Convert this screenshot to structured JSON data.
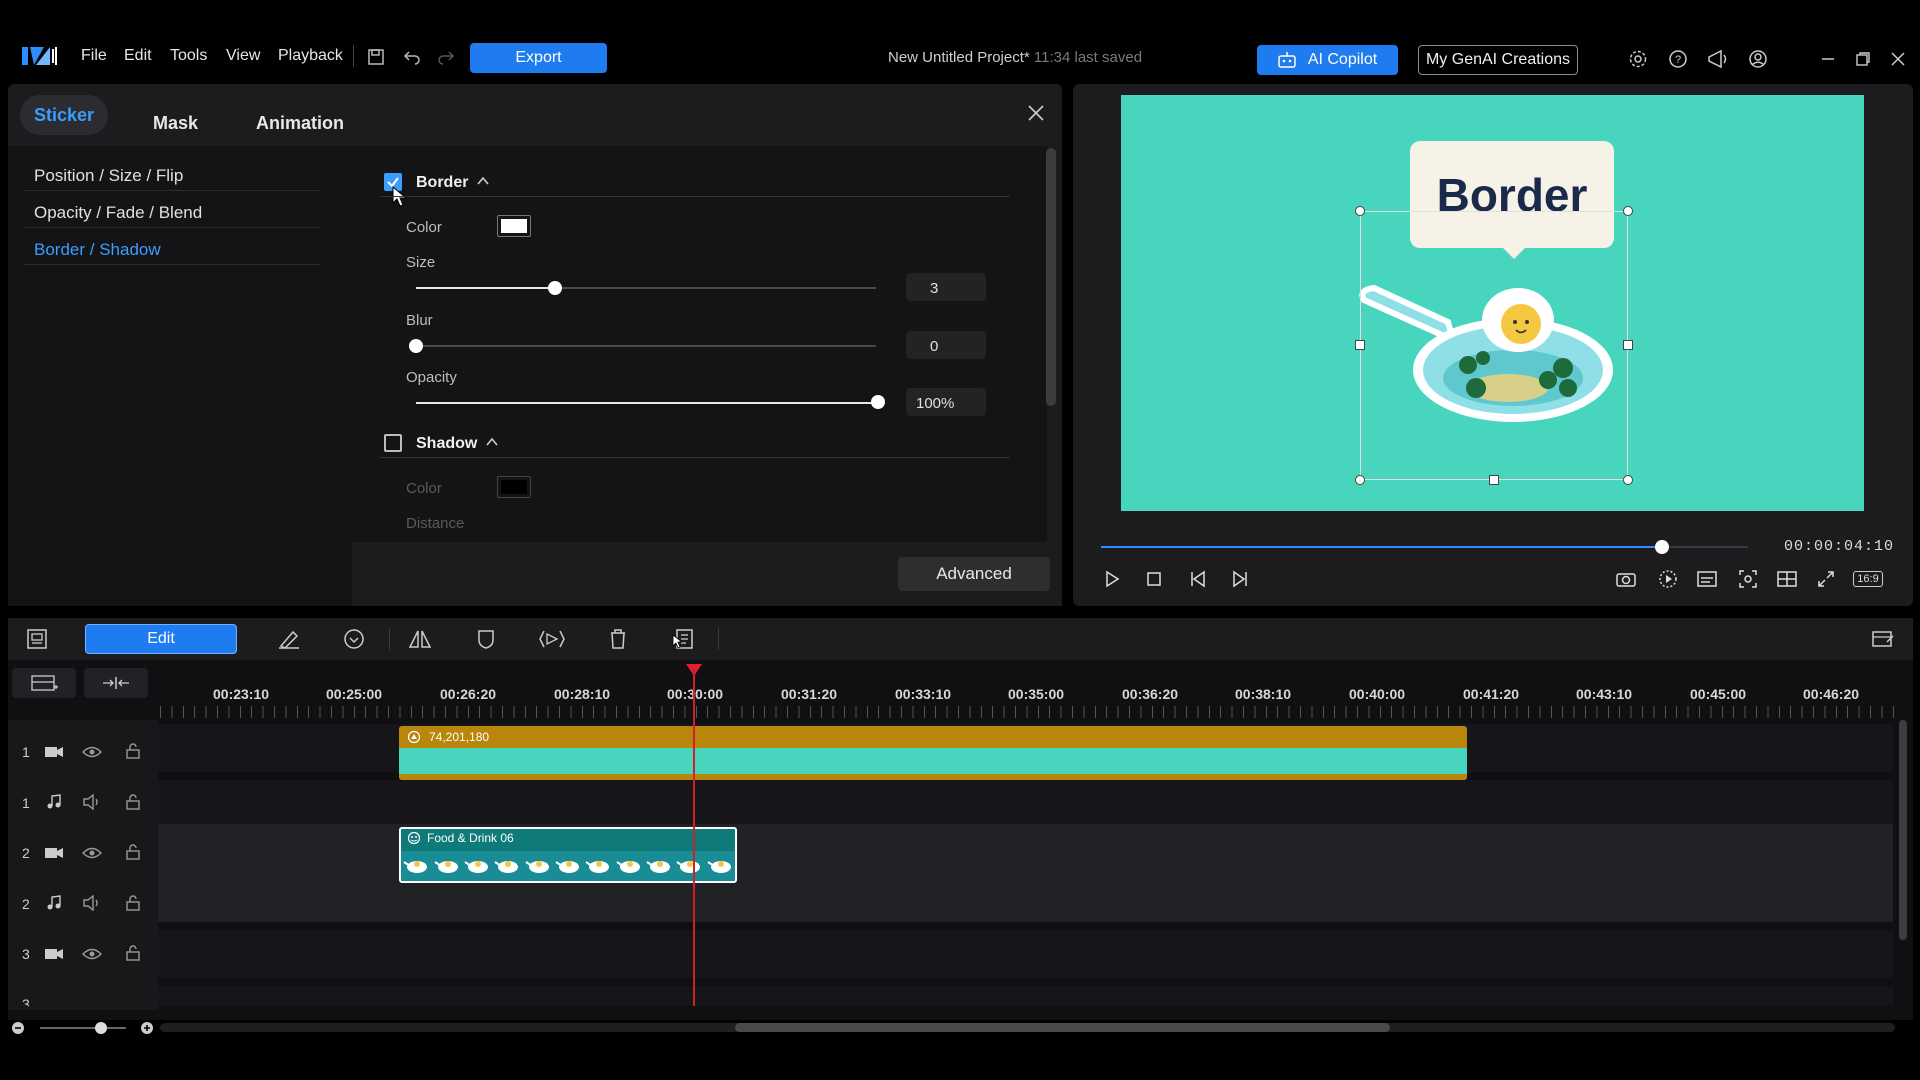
{
  "app": {
    "menu": [
      "File",
      "Edit",
      "Tools",
      "View",
      "Playback"
    ],
    "export_label": "Export",
    "project_title": "New Untitled Project*",
    "last_saved": "11:34 last saved",
    "ai_copilot_label": "AI Copilot",
    "genai_label": "My GenAI Creations",
    "accent": "#1e7cf0"
  },
  "panel": {
    "tabs": [
      "Sticker",
      "Mask",
      "Animation"
    ],
    "active_tab": "Sticker",
    "nav": [
      "Position / Size / Flip",
      "Opacity / Fade / Blend",
      "Border / Shadow"
    ],
    "active_nav": "Border / Shadow",
    "border": {
      "title": "Border",
      "checked": true,
      "color_label": "Color",
      "color_value": "#ffffff",
      "size_label": "Size",
      "size_value": "3",
      "blur_label": "Blur",
      "blur_value": "0",
      "opacity_label": "Opacity",
      "opacity_value": "100%"
    },
    "shadow": {
      "title": "Shadow",
      "checked": false,
      "color_label": "Color",
      "color_value": "#000000",
      "distance_label": "Distance"
    },
    "advanced_label": "Advanced"
  },
  "preview": {
    "sticker_text": "Border",
    "canvas_color": "#47d5bd",
    "timecode": "00:00:04:10",
    "progress": 0.86,
    "aspect": "16:9"
  },
  "toolbar": {
    "edit_label": "Edit"
  },
  "timeline": {
    "ruler": [
      "00:23:10",
      "00:25:00",
      "00:26:20",
      "00:28:10",
      "00:30:00",
      "00:31:20",
      "00:33:10",
      "00:35:00",
      "00:36:20",
      "00:38:10",
      "00:40:00",
      "00:41:20",
      "00:43:10",
      "00:45:00",
      "00:46:20"
    ],
    "tracks": [
      "1",
      "1",
      "2",
      "2",
      "3",
      "3"
    ],
    "clip1_label": "74,201,180",
    "clip2_label": "Food & Drink 06"
  }
}
